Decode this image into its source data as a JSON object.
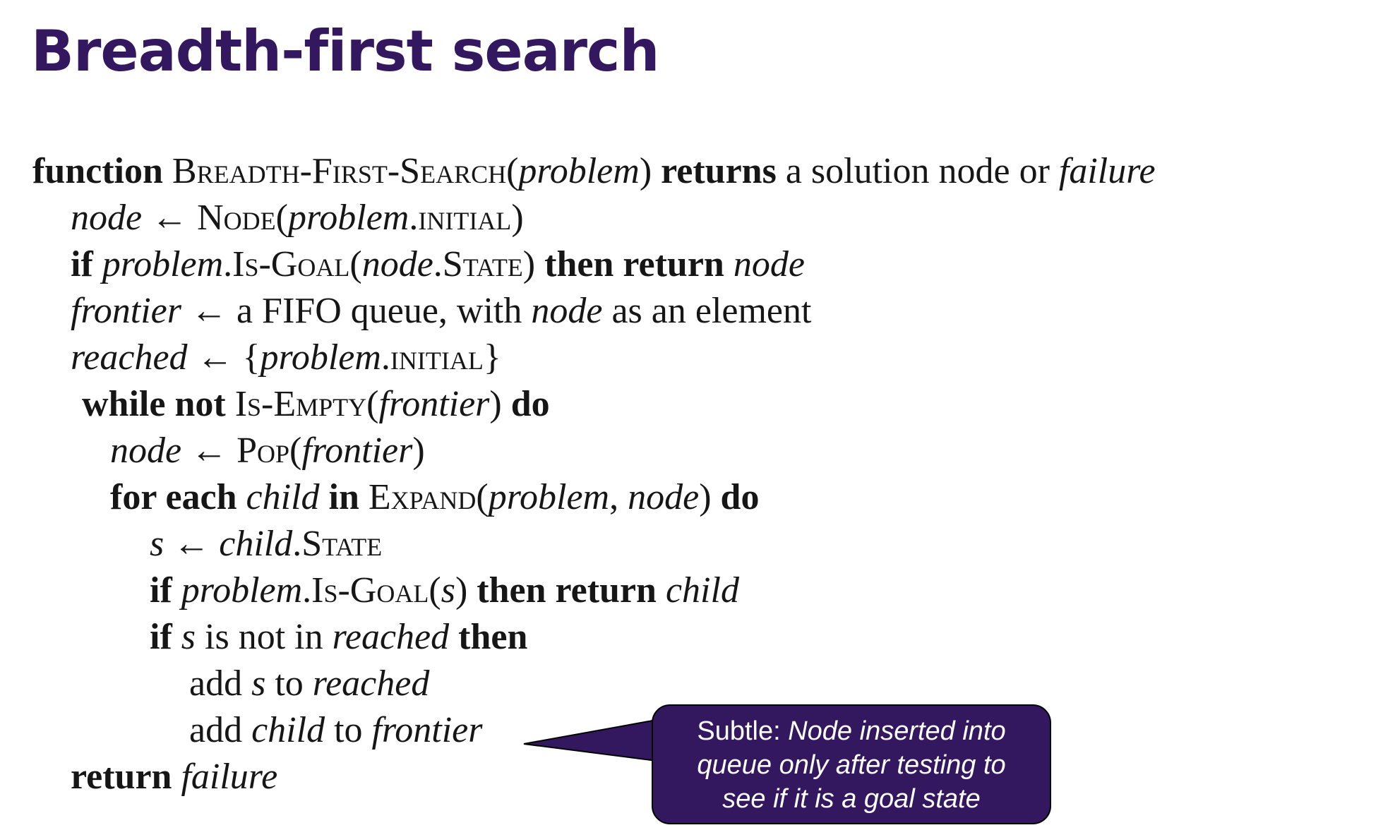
{
  "slide": {
    "title": "Breadth-first search"
  },
  "pseudocode": {
    "lines": [
      {
        "tokens": [
          {
            "text": "function",
            "style": "kw"
          },
          {
            "text": " ",
            "style": ""
          },
          {
            "text": "Breadth-First-Search",
            "style": "sc"
          },
          {
            "text": "(",
            "style": ""
          },
          {
            "text": "problem",
            "style": "it"
          },
          {
            "text": ") ",
            "style": ""
          },
          {
            "text": "returns",
            "style": "kw"
          },
          {
            "text": " a solution node or ",
            "style": ""
          },
          {
            "text": "failure",
            "style": "it"
          }
        ]
      },
      {
        "tokens": [
          {
            "text": "node",
            "style": "it"
          },
          {
            "text": " ← ",
            "style": ""
          },
          {
            "text": "Node",
            "style": "sc"
          },
          {
            "text": "(",
            "style": ""
          },
          {
            "text": "problem",
            "style": "it"
          },
          {
            "text": ".",
            "style": ""
          },
          {
            "text": "initial",
            "style": "sc"
          },
          {
            "text": ")",
            "style": ""
          }
        ]
      },
      {
        "tokens": [
          {
            "text": "if",
            "style": "kw"
          },
          {
            "text": " ",
            "style": ""
          },
          {
            "text": "problem",
            "style": "it"
          },
          {
            "text": ".",
            "style": ""
          },
          {
            "text": "Is-Goal",
            "style": "sc"
          },
          {
            "text": "(",
            "style": ""
          },
          {
            "text": "node",
            "style": "it"
          },
          {
            "text": ".",
            "style": ""
          },
          {
            "text": "State",
            "style": "sc"
          },
          {
            "text": ") ",
            "style": ""
          },
          {
            "text": "then return",
            "style": "kw"
          },
          {
            "text": " ",
            "style": ""
          },
          {
            "text": "node",
            "style": "it"
          }
        ]
      },
      {
        "tokens": [
          {
            "text": "frontier",
            "style": "it"
          },
          {
            "text": " ← a FIFO queue, with ",
            "style": ""
          },
          {
            "text": "node",
            "style": "it"
          },
          {
            "text": " as an element",
            "style": ""
          }
        ]
      },
      {
        "tokens": [
          {
            "text": "reached",
            "style": "it"
          },
          {
            "text": " ← {",
            "style": ""
          },
          {
            "text": "problem",
            "style": "it"
          },
          {
            "text": ".",
            "style": ""
          },
          {
            "text": "initial",
            "style": "sc"
          },
          {
            "text": "}",
            "style": ""
          }
        ]
      },
      {
        "tokens": [
          {
            "text": "while not",
            "style": "kw"
          },
          {
            "text": " ",
            "style": ""
          },
          {
            "text": "Is-Empty",
            "style": "sc"
          },
          {
            "text": "(",
            "style": ""
          },
          {
            "text": "frontier",
            "style": "it"
          },
          {
            "text": ") ",
            "style": ""
          },
          {
            "text": "do",
            "style": "kw"
          }
        ]
      },
      {
        "tokens": [
          {
            "text": "node",
            "style": "it"
          },
          {
            "text": " ← ",
            "style": ""
          },
          {
            "text": "Pop",
            "style": "sc"
          },
          {
            "text": "(",
            "style": ""
          },
          {
            "text": "frontier",
            "style": "it"
          },
          {
            "text": ")",
            "style": ""
          }
        ]
      },
      {
        "tokens": [
          {
            "text": "for each",
            "style": "kw"
          },
          {
            "text": " ",
            "style": ""
          },
          {
            "text": "child",
            "style": "it"
          },
          {
            "text": " ",
            "style": ""
          },
          {
            "text": "in",
            "style": "kw"
          },
          {
            "text": " ",
            "style": ""
          },
          {
            "text": "Expand",
            "style": "sc"
          },
          {
            "text": "(",
            "style": ""
          },
          {
            "text": "problem",
            "style": "it"
          },
          {
            "text": ", ",
            "style": ""
          },
          {
            "text": "node",
            "style": "it"
          },
          {
            "text": ") ",
            "style": ""
          },
          {
            "text": "do",
            "style": "kw"
          }
        ]
      },
      {
        "tokens": [
          {
            "text": "s",
            "style": "it"
          },
          {
            "text": " ← ",
            "style": ""
          },
          {
            "text": "child",
            "style": "it"
          },
          {
            "text": ".",
            "style": ""
          },
          {
            "text": "State",
            "style": "sc"
          }
        ]
      },
      {
        "tokens": [
          {
            "text": "if",
            "style": "kw"
          },
          {
            "text": " ",
            "style": ""
          },
          {
            "text": "problem",
            "style": "it"
          },
          {
            "text": ".",
            "style": ""
          },
          {
            "text": "Is-Goal",
            "style": "sc"
          },
          {
            "text": "(",
            "style": ""
          },
          {
            "text": "s",
            "style": "it"
          },
          {
            "text": ") ",
            "style": ""
          },
          {
            "text": "then return",
            "style": "kw"
          },
          {
            "text": " ",
            "style": ""
          },
          {
            "text": "child",
            "style": "it"
          }
        ]
      },
      {
        "tokens": [
          {
            "text": "if",
            "style": "kw"
          },
          {
            "text": " ",
            "style": ""
          },
          {
            "text": "s",
            "style": "it"
          },
          {
            "text": " is not in ",
            "style": ""
          },
          {
            "text": "reached",
            "style": "it"
          },
          {
            "text": " ",
            "style": ""
          },
          {
            "text": "then",
            "style": "kw"
          }
        ]
      },
      {
        "tokens": [
          {
            "text": "add ",
            "style": ""
          },
          {
            "text": "s",
            "style": "it"
          },
          {
            "text": " to ",
            "style": ""
          },
          {
            "text": "reached",
            "style": "it"
          }
        ]
      },
      {
        "tokens": [
          {
            "text": "add ",
            "style": ""
          },
          {
            "text": "child",
            "style": "it"
          },
          {
            "text": " to ",
            "style": ""
          },
          {
            "text": "frontier",
            "style": "it"
          }
        ]
      },
      {
        "tokens": [
          {
            "text": "return",
            "style": "kw"
          },
          {
            "text": " ",
            "style": ""
          },
          {
            "text": "failure",
            "style": "it"
          }
        ]
      }
    ]
  },
  "callout": {
    "prefix": "Subtle:  ",
    "line1_rest": "Node inserted into",
    "line2": "queue only after testing to",
    "line3": "see if it is a goal state",
    "background_color": "#33175f",
    "text_color": "#ffffff"
  },
  "colors": {
    "title": "#33175f",
    "text": "#161616"
  }
}
